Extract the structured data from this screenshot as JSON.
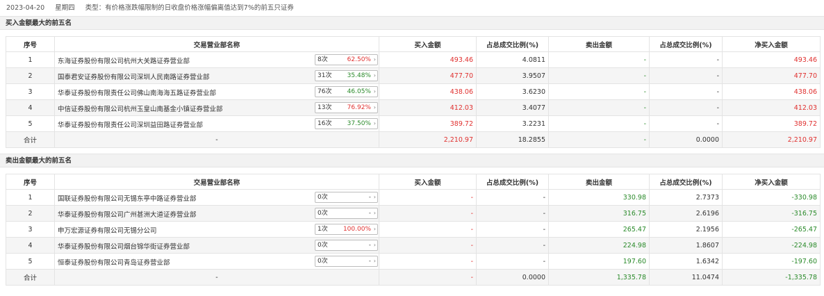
{
  "header": {
    "date": "2023-04-20",
    "weekday": "星期四",
    "type_label": "类型：有价格涨跌幅限制的日收盘价格涨幅偏离值达到7%的前五只证券"
  },
  "columns": [
    "序号",
    "交易营业部名称",
    "买入金额",
    "占总成交比例(%)",
    "卖出金额",
    "占总成交比例(%)",
    "净买入金额"
  ],
  "buy_section": {
    "title": "买入金额最大的前五名",
    "rows": [
      {
        "idx": "1",
        "name": "东海证券股份有限公司杭州大关路证券营业部",
        "count": "8次",
        "pct": "62.50%",
        "buy": "493.46",
        "buy_ratio": "4.0811",
        "sell": "-",
        "sell_ratio": "-",
        "net": "493.46"
      },
      {
        "idx": "2",
        "name": "国泰君安证券股份有限公司深圳人民南路证券营业部",
        "count": "31次",
        "pct": "35.48%",
        "buy": "477.70",
        "buy_ratio": "3.9507",
        "sell": "-",
        "sell_ratio": "-",
        "net": "477.70"
      },
      {
        "idx": "3",
        "name": "华泰证券股份有限责任公司佛山南海海五路证券营业部",
        "count": "76次",
        "pct": "46.05%",
        "buy": "438.06",
        "buy_ratio": "3.6230",
        "sell": "-",
        "sell_ratio": "-",
        "net": "438.06"
      },
      {
        "idx": "4",
        "name": "中信证券股份有限公司杭州玉皇山南基金小镇证券营业部",
        "count": "13次",
        "pct": "76.92%",
        "buy": "412.03",
        "buy_ratio": "3.4077",
        "sell": "-",
        "sell_ratio": "-",
        "net": "412.03"
      },
      {
        "idx": "5",
        "name": "华泰证券股份有限责任公司深圳益田路证券营业部",
        "count": "16次",
        "pct": "37.50%",
        "buy": "389.72",
        "buy_ratio": "3.2231",
        "sell": "-",
        "sell_ratio": "-",
        "net": "389.72"
      }
    ],
    "total": {
      "label": "合计",
      "name": "-",
      "buy": "2,210.97",
      "buy_ratio": "18.2855",
      "sell": "-",
      "sell_ratio": "0.0000",
      "net": "2,210.97"
    }
  },
  "sell_section": {
    "title": "卖出金额最大的前五名",
    "rows": [
      {
        "idx": "1",
        "name": "国联证券股份有限公司无锡东亭中路证券营业部",
        "count": "0次",
        "pct": "-",
        "buy": "-",
        "buy_ratio": "-",
        "sell": "330.98",
        "sell_ratio": "2.7373",
        "net": "-330.98"
      },
      {
        "idx": "2",
        "name": "华泰证券股份有限公司广州甚洲大道证券营业部",
        "count": "0次",
        "pct": "-",
        "buy": "-",
        "buy_ratio": "-",
        "sell": "316.75",
        "sell_ratio": "2.6196",
        "net": "-316.75"
      },
      {
        "idx": "3",
        "name": "申万宏源证券有限公司无锡分公司",
        "count": "1次",
        "pct": "100.00%",
        "buy": "-",
        "buy_ratio": "-",
        "sell": "265.47",
        "sell_ratio": "2.1956",
        "net": "-265.47"
      },
      {
        "idx": "4",
        "name": "华泰证券股份有限公司烟台锦华街证券营业部",
        "count": "0次",
        "pct": "-",
        "buy": "-",
        "buy_ratio": "-",
        "sell": "224.98",
        "sell_ratio": "1.8607",
        "net": "-224.98"
      },
      {
        "idx": "5",
        "name": "恒泰证券股份有限公司青岛证券营业部",
        "count": "0次",
        "pct": "-",
        "buy": "-",
        "buy_ratio": "-",
        "sell": "197.60",
        "sell_ratio": "1.6342",
        "net": "-197.60"
      }
    ],
    "total": {
      "label": "合计",
      "name": "-",
      "buy": "-",
      "buy_ratio": "0.0000",
      "sell": "1,335.78",
      "sell_ratio": "11.0474",
      "net": "-1,335.78"
    }
  },
  "colors": {
    "positive": "#e0302f",
    "negative": "#2a8a2a"
  },
  "icons": {
    "dropdown": "chevron-right-icon"
  }
}
